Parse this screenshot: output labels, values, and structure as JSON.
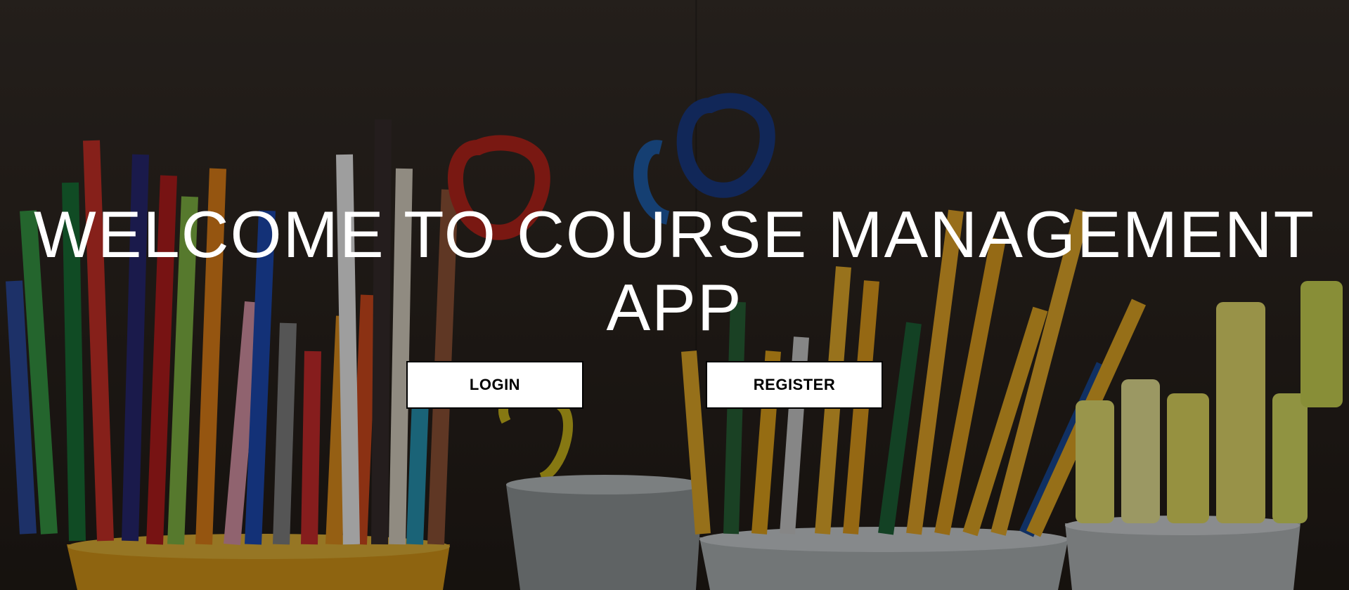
{
  "hero": {
    "title": "WELCOME TO COURSE MANAGEMENT APP"
  },
  "actions": {
    "login_label": "LOGIN",
    "register_label": "REGISTER"
  },
  "background": {
    "subject": "pencils, scissors and highlighters in metal buckets"
  }
}
